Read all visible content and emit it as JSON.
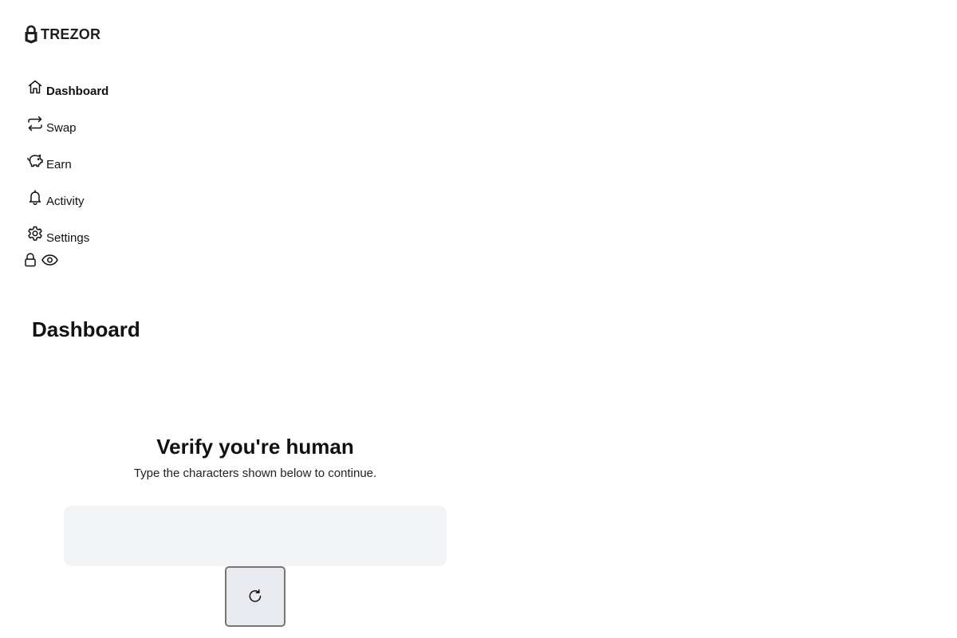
{
  "brand": {
    "name": "TREZOR",
    "logo_icon": "trezor-lock-logo-icon"
  },
  "sidebar": {
    "items": [
      {
        "label": "Dashboard",
        "icon": "home-icon",
        "active": true
      },
      {
        "label": "Swap",
        "icon": "swap-arrows-icon",
        "active": false
      },
      {
        "label": "Earn",
        "icon": "piggy-bank-icon",
        "active": false
      },
      {
        "label": "Activity",
        "icon": "bell-icon",
        "active": false
      },
      {
        "label": "Settings",
        "icon": "gear-icon",
        "active": false
      }
    ],
    "quick_actions": [
      {
        "icon": "lock-icon"
      },
      {
        "icon": "eye-icon"
      }
    ]
  },
  "main": {
    "title": "Dashboard",
    "captcha": {
      "heading": "Verify you're human",
      "instructions": "Type the characters shown below to continue.",
      "refresh_icon": "refresh-icon"
    }
  },
  "colors": {
    "text": "#111111",
    "captcha_box_bg": "#f3f4f6",
    "refresh_button_bg": "#e9eaef",
    "refresh_button_border": "#767676"
  }
}
